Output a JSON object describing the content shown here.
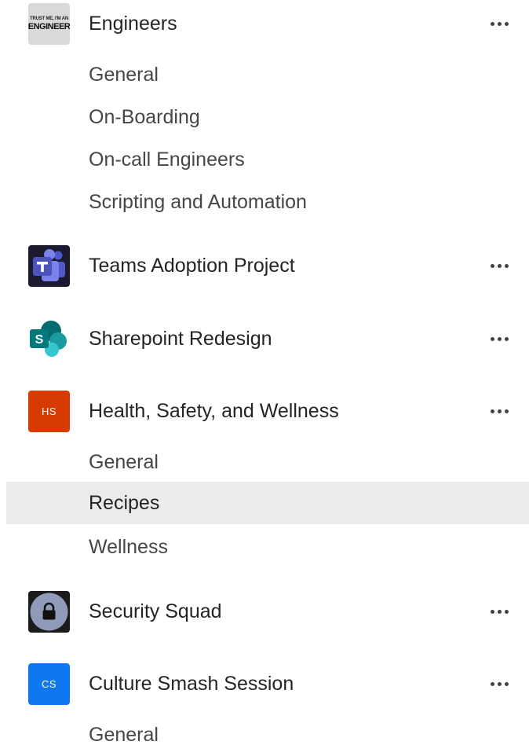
{
  "teams": [
    {
      "name": "Engineers",
      "avatar": {
        "kind": "image",
        "text_small": "TRUST ME, I'M AN",
        "text_large": "ENGINEER"
      },
      "channels": [
        "General",
        "On-Boarding",
        "On-call Engineers",
        "Scripting and Automation"
      ]
    },
    {
      "name": "Teams Adoption Project",
      "avatar": {
        "kind": "logo",
        "icon": "microsoft-teams-icon"
      },
      "channels": []
    },
    {
      "name": "Sharepoint Redesign",
      "avatar": {
        "kind": "logo",
        "icon": "sharepoint-icon"
      },
      "channels": []
    },
    {
      "name": "Health, Safety, and Wellness",
      "avatar": {
        "kind": "initials",
        "initials": "HS",
        "color": "#d83b01"
      },
      "channels": [
        "General",
        "Recipes",
        "Wellness"
      ],
      "selected_channel": "Recipes"
    },
    {
      "name": "Security Squad",
      "avatar": {
        "kind": "icon",
        "icon": "lock-icon"
      },
      "channels": []
    },
    {
      "name": "Culture Smash Session",
      "avatar": {
        "kind": "initials",
        "initials": "CS",
        "color": "#0f78f0"
      },
      "channels": [
        "General"
      ]
    }
  ],
  "colors": {
    "selected_row_bg": "#ebebeb",
    "team_text": "#252423",
    "channel_text": "#484644"
  }
}
